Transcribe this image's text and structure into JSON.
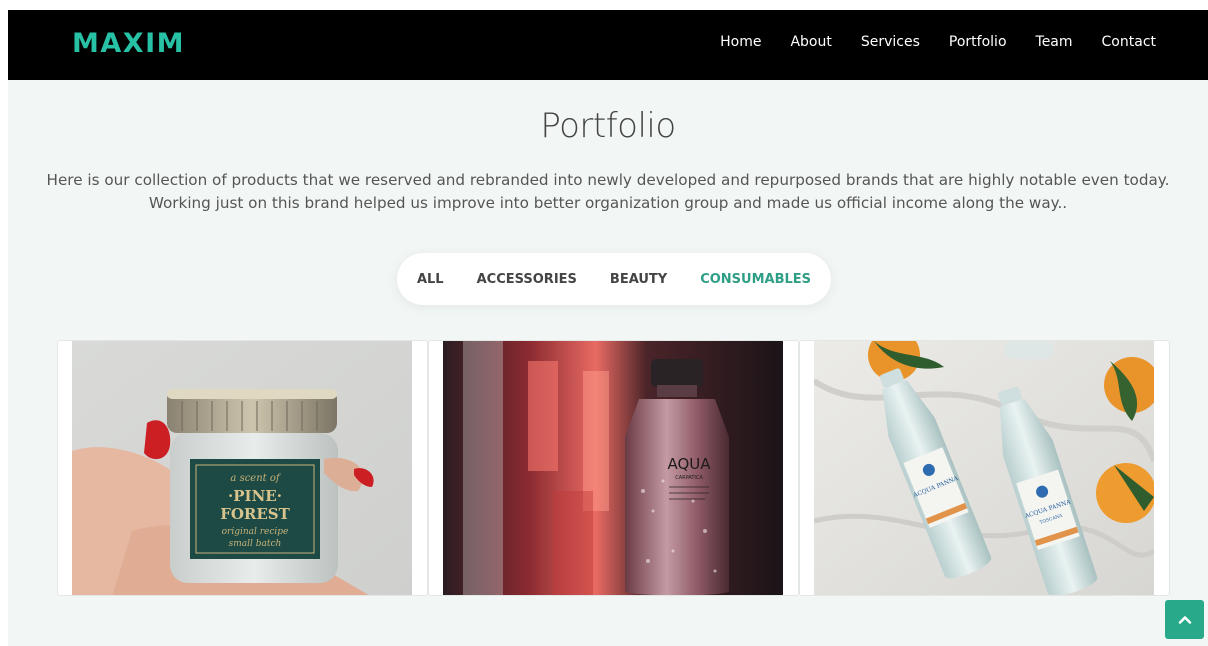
{
  "header": {
    "brand": "MAXIM",
    "nav": [
      "Home",
      "About",
      "Services",
      "Portfolio",
      "Team",
      "Contact"
    ]
  },
  "portfolio": {
    "title": "Portfolio",
    "description_line1": "Here is our collection of products that we reserved and rebranded into newly developed and repurposed brands that are highly notable even today.",
    "description_line2": "Working just on this brand helped us improve into better organization  group and made us official income along the way..",
    "filters": [
      {
        "label": "ALL",
        "active": false
      },
      {
        "label": "ACCESSORIES",
        "active": false
      },
      {
        "label": "BEAUTY",
        "active": false
      },
      {
        "label": "CONSUMABLES",
        "active": true
      }
    ],
    "items": [
      {
        "name": "pine-forest-jar",
        "label_lines": [
          "a scent of",
          "·PINE·",
          "FOREST",
          "original recipe",
          "small batch"
        ]
      },
      {
        "name": "aqua-bottle",
        "label_lines": [
          "AQUA",
          "CARPATICA"
        ]
      },
      {
        "name": "acqua-panna-bottles",
        "label_lines": [
          "ACQUA PANNA",
          "TOSCANA"
        ]
      }
    ]
  },
  "colors": {
    "accent": "#27c1a6",
    "active_filter": "#2f9e86",
    "navbar_bg": "#000000",
    "page_bg": "#f2f7f6",
    "scroll_top_button": "#27a98a"
  },
  "icons": {
    "scroll_top": "chevron-up-icon"
  }
}
